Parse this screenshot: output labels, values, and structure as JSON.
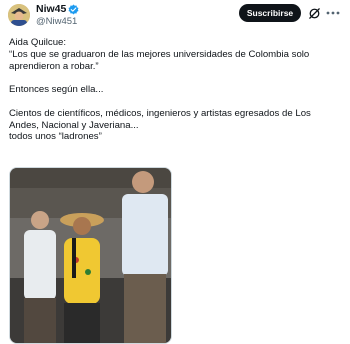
{
  "post": {
    "author": {
      "display_name": "Niw45",
      "handle": "@Niw451",
      "verified": true,
      "avatar_icon": "avatar-image"
    },
    "subscribe_label": "Suscribirse",
    "grok_icon": "grok-icon",
    "more_icon": "more-options-icon",
    "text": "Aida Quilcue:\n“Los que se graduaron de las mejores universidades de Colombia solo aprendieron a robar.”\n\nEntonces según ella...\n\nCientos de científicos, médicos, ingenieros y artistas egresados de Los Andes, Nacional y Javeriana...\ntodos unos “ladrones”",
    "media": {
      "type": "photo"
    }
  },
  "colors": {
    "verified_blue": "#1d9bf0",
    "button_bg": "#0f1419",
    "secondary_text": "#536471"
  }
}
